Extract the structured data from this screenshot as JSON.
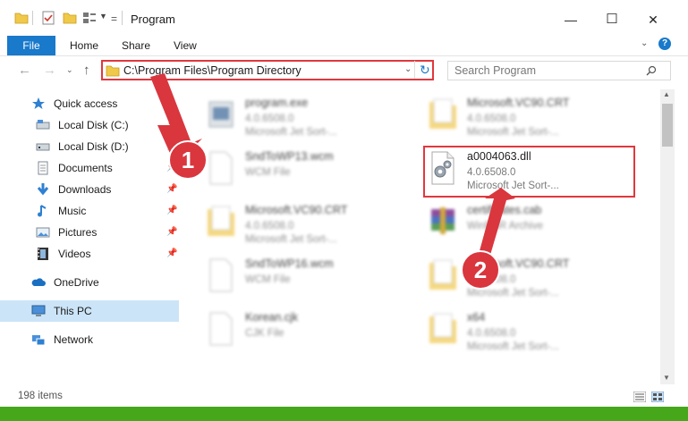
{
  "window": {
    "title": "Program",
    "minimize": "—",
    "maximize": "☐",
    "close": "✕"
  },
  "ribbon": {
    "file": "File",
    "home": "Home",
    "share": "Share",
    "view": "View",
    "help": "?"
  },
  "address": {
    "path": "C:\\Program Files\\Program Directory",
    "search_placeholder": "Search Program"
  },
  "sidebar": {
    "quick_access": "Quick access",
    "local_c": "Local Disk (C:)",
    "local_d": "Local Disk (D:)",
    "documents": "Documents",
    "downloads": "Downloads",
    "music": "Music",
    "pictures": "Pictures",
    "videos": "Videos",
    "onedrive": "OneDrive",
    "this_pc": "This PC",
    "network": "Network"
  },
  "files": {
    "f1": {
      "name": "program.exe",
      "line1": "4.0.6508.0",
      "line2": "Microsoft Jet Sort-..."
    },
    "f2": {
      "name": "Microsoft.VC90.CRT",
      "line1": "4.0.6508.0",
      "line2": "Microsoft Jet Sort-..."
    },
    "f3": {
      "name": "SndToWP13.wcm",
      "line1": "WCM File"
    },
    "f4": {
      "name": "a0004063.dll",
      "line1": "4.0.6508.0",
      "line2": "Microsoft Jet Sort-..."
    },
    "f5": {
      "name": "Microsoft.VC90.CRT",
      "line1": "4.0.6508.0",
      "line2": "Microsoft Jet Sort-..."
    },
    "f6": {
      "name": "certificates.cab",
      "line1": "WinRAR Archive"
    },
    "f7": {
      "name": "SndToWP16.wcm",
      "line1": "WCM File"
    },
    "f8": {
      "name": "Microsoft.VC90.CRT",
      "line1": "4.0.6508.0",
      "line2": "Microsoft Jet Sort-..."
    },
    "f9": {
      "name": "Korean.cjk",
      "line1": "CJK File"
    },
    "f10": {
      "name": "x64",
      "line1": "4.0.6508.0",
      "line2": "Microsoft Jet Sort-..."
    }
  },
  "callouts": {
    "one": "1",
    "two": "2"
  },
  "status": {
    "items": "198 items"
  },
  "colors": {
    "accent": "#1979ca",
    "highlight": "#e0383e",
    "selection": "#cce4f7",
    "bottom_bar": "#46a71a"
  }
}
